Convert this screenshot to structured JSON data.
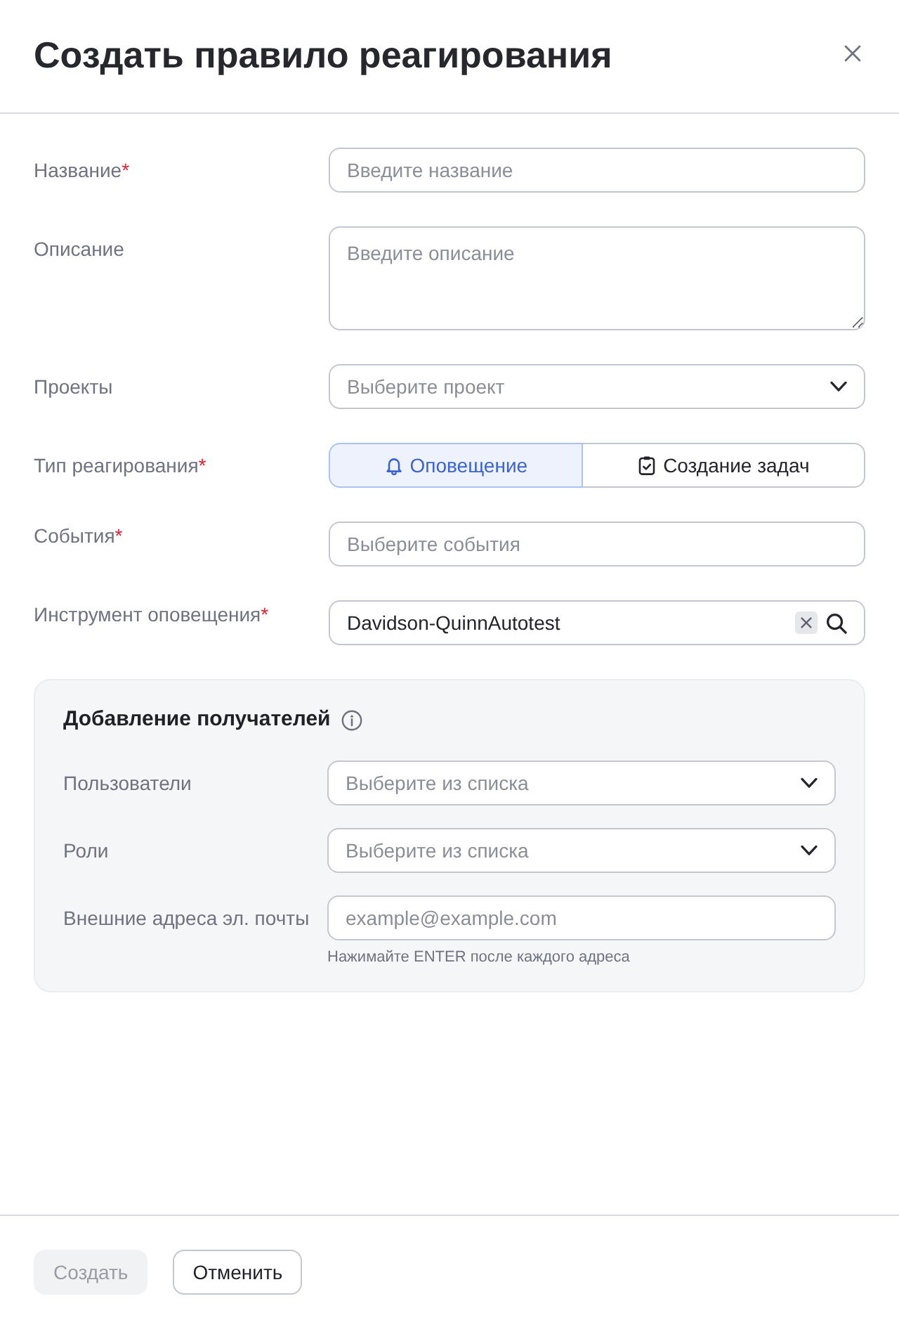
{
  "dialog": {
    "title": "Создать правило реагирования"
  },
  "fields": [
    {
      "kind": "input",
      "label": "Название",
      "required_mark": "*",
      "placeholder": "Введите название"
    },
    {
      "kind": "textarea",
      "label": "Описание",
      "placeholder": "Введите описание"
    },
    {
      "kind": "select",
      "label": "Проекты",
      "placeholder": "Выберите проект"
    },
    {
      "kind": "toggle",
      "label": "Тип реагирования",
      "required_mark": "*",
      "options": [
        {
          "label": "Оповещение",
          "selected": true
        },
        {
          "label": "Создание задач",
          "selected": false
        }
      ]
    },
    {
      "kind": "input",
      "label": "События",
      "required_mark": "*",
      "placeholder": "Выберите события"
    },
    {
      "kind": "search",
      "label": "Инструмент оповещения",
      "required_mark": "*",
      "value": "Davidson-QuinnAutotest"
    }
  ],
  "recipients": {
    "title": "Добавление получателей",
    "fields": [
      {
        "kind": "select",
        "label": "Пользователи",
        "placeholder": "Выберите из списка"
      },
      {
        "kind": "select",
        "label": "Роли",
        "placeholder": "Выберите из списка"
      },
      {
        "kind": "input",
        "label": "Внешние адреса эл. почты",
        "placeholder": "example@example.com",
        "hint": "Нажимайте ENTER после каждого адреса"
      }
    ]
  },
  "buttons": [
    {
      "label": "Создать",
      "disabled": true
    },
    {
      "label": "Отменить",
      "disabled": false
    }
  ]
}
